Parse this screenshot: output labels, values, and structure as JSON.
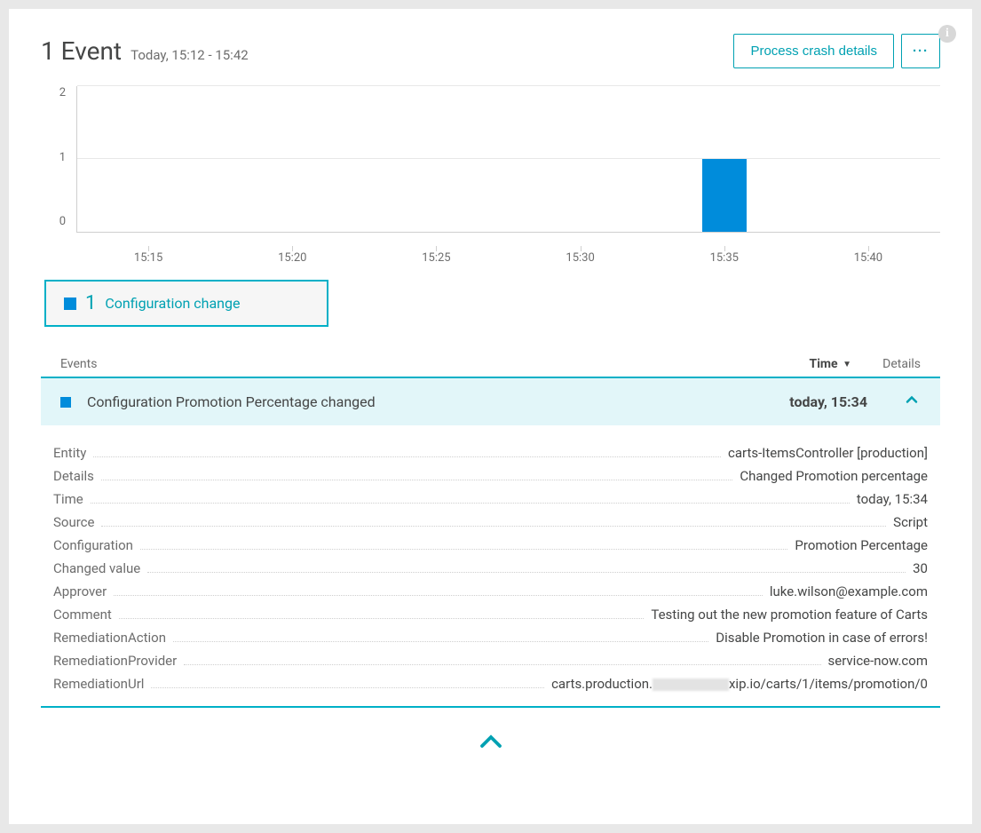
{
  "header": {
    "title": "1 Event",
    "subtitle": "Today, 15:12 - 15:42",
    "primary_button": "Process crash details",
    "menu_button": "···"
  },
  "chart_data": {
    "type": "bar",
    "categories": [
      "15:15",
      "15:20",
      "15:25",
      "15:30",
      "15:35",
      "15:40"
    ],
    "values": [
      0,
      0,
      0,
      0,
      1,
      0
    ],
    "ylim": [
      0,
      2
    ],
    "yticks": [
      0,
      1,
      2
    ],
    "series_name": "Configuration change",
    "title": "",
    "xlabel": "",
    "ylabel": ""
  },
  "legend": {
    "count": "1",
    "label": "Configuration change"
  },
  "table": {
    "col_events": "Events",
    "col_time": "Time",
    "col_details": "Details"
  },
  "event": {
    "name": "Configuration Promotion Percentage changed",
    "time": "today, 15:34"
  },
  "details": [
    {
      "key": "Entity",
      "value": "carts-ItemsController [production]"
    },
    {
      "key": "Details",
      "value": "Changed Promotion percentage"
    },
    {
      "key": "Time",
      "value": "today, 15:34"
    },
    {
      "key": "Source",
      "value": "Script"
    },
    {
      "key": "Configuration",
      "value": "Promotion Percentage"
    },
    {
      "key": "Changed value",
      "value": "30"
    },
    {
      "key": "Approver",
      "value": "luke.wilson@example.com"
    },
    {
      "key": "Comment",
      "value": "Testing out the new promotion feature of Carts"
    },
    {
      "key": "RemediationAction",
      "value": "Disable Promotion in case of errors!"
    },
    {
      "key": "RemediationProvider",
      "value": "service-now.com"
    },
    {
      "key": "RemediationUrl",
      "value_prefix": "carts.production.",
      "value_suffix": "xip.io/carts/1/items/promotion/0",
      "redacted": true
    }
  ]
}
